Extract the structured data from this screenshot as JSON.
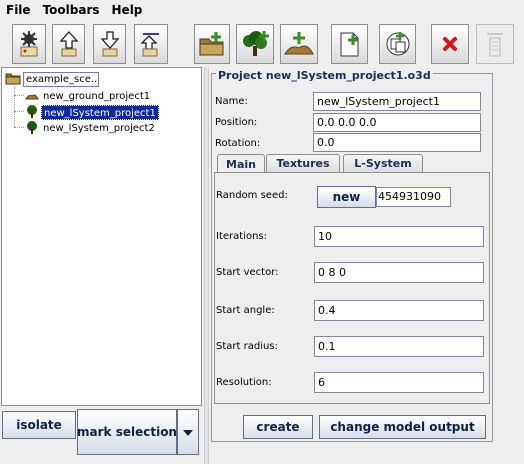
{
  "menu": {
    "file": "File",
    "toolbars": "Toolbars",
    "help": "Help"
  },
  "toolbar": {
    "buttons": [
      {
        "name": "gear-load-icon"
      },
      {
        "name": "upload-icon"
      },
      {
        "name": "download-icon"
      },
      {
        "name": "export-icon"
      },
      {
        "name": "open-folder-icon"
      },
      {
        "name": "add-tree-icon"
      },
      {
        "name": "add-ground-icon"
      },
      {
        "name": "new-document-icon"
      },
      {
        "name": "merge-icon"
      },
      {
        "name": "delete-icon"
      },
      {
        "name": "disabled-tool-icon"
      }
    ],
    "accent_red": "#d01818",
    "accent_green": "#3c8a2a"
  },
  "tree": {
    "root_label": "example_sce...",
    "items": [
      {
        "label": "new_ground_project1"
      },
      {
        "label": "new_lSystem_project1"
      },
      {
        "label": "new_lSystem_project2"
      }
    ],
    "selected_color": "#102a9a"
  },
  "left_buttons": {
    "isolate": "isolate",
    "mark_selection": "mark selection"
  },
  "project": {
    "title": "Project new_lSystem_project1.o3d",
    "name_label": "Name:",
    "name_value": "new_lSystem_project1",
    "position_label": "Position:",
    "position_value": "0.0 0.0 0.0",
    "rotation_label": "Rotation:",
    "rotation_value": "0.0"
  },
  "tabs": {
    "main": "Main",
    "textures": "Textures",
    "lsystem": "L-System"
  },
  "main_tab": {
    "random_seed_label": "Random seed:",
    "new_button": "new",
    "random_seed_value": "454931090",
    "iterations_label": "Iterations:",
    "iterations_value": "10",
    "start_vector_label": "Start vector:",
    "start_vector_value": "0 8 0",
    "start_angle_label": "Start angle:",
    "start_angle_value": "0.4",
    "start_radius_label": "Start radius:",
    "start_radius_value": "0.1",
    "resolution_label": "Resolution:",
    "resolution_value": "6"
  },
  "actions": {
    "create": "create",
    "change_model_output": "change model output"
  }
}
